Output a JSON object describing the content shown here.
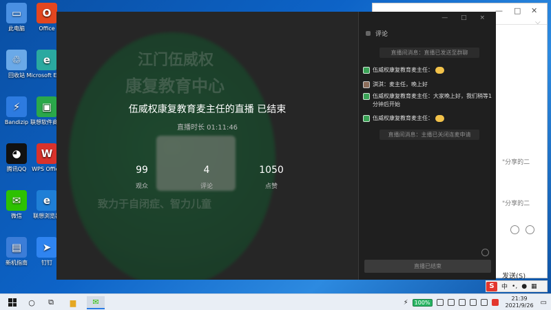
{
  "desktop": {
    "icons": [
      {
        "label": "此电脑",
        "color": "#4a90e2",
        "glyph": "▭",
        "icon": "computer-icon"
      },
      {
        "label": "Office",
        "color": "#e3461f",
        "glyph": "O",
        "icon": "office-icon"
      },
      {
        "label": "回收站",
        "color": "#6aa9e8",
        "glyph": "♲",
        "icon": "recycle-bin-icon"
      },
      {
        "label": "Microsoft Edge",
        "color": "#2aa9a0",
        "glyph": "e",
        "icon": "edge-icon"
      },
      {
        "label": "Bandizip",
        "color": "#2d7be0",
        "glyph": "⚡",
        "icon": "bandizip-icon"
      },
      {
        "label": "联想软件商店",
        "color": "#2aa84a",
        "glyph": "▣",
        "icon": "store-icon"
      },
      {
        "label": "腾讯QQ",
        "color": "#111111",
        "glyph": "◕",
        "icon": "qq-icon"
      },
      {
        "label": "WPS Office",
        "color": "#d9322b",
        "glyph": "W",
        "icon": "wps-icon"
      },
      {
        "label": "微信",
        "color": "#2dc100",
        "glyph": "✉",
        "icon": "wechat-icon"
      },
      {
        "label": "联想浏览器",
        "color": "#1f7fd6",
        "glyph": "e",
        "icon": "lenovo-browser-icon"
      },
      {
        "label": "新机指南",
        "color": "#3b7dd8",
        "glyph": "▤",
        "icon": "guide-icon"
      },
      {
        "label": "钉钉",
        "color": "#2f84f0",
        "glyph": "➤",
        "icon": "dingtalk-icon"
      }
    ]
  },
  "bg_window": {
    "snip1": "\"分享的二",
    "snip2": "\"分享的二",
    "send_label": "发送(S)"
  },
  "live": {
    "cover_line1": "江门伍威权",
    "cover_line2": "康复教育中心",
    "cover_line3": "致力于自闭症、智力儿童",
    "title": "伍威权康复教育麦主任的直播 已结束",
    "duration": "直播时长 01:11:46",
    "stats": [
      {
        "value": "99",
        "label": "观众"
      },
      {
        "value": "4",
        "label": "评论"
      },
      {
        "value": "1050",
        "label": "点赞"
      }
    ]
  },
  "comments": {
    "controls": "— □ ×",
    "header": "评论",
    "sys1": "直播间消息：直播已发送至群聊",
    "items": [
      {
        "text": "伍威权康复教育麦主任：",
        "emoji": true
      },
      {
        "text": "淇淇：麦主任，晚上好",
        "emoji": false
      },
      {
        "text": "伍威权康复教育麦主任：大家晚上好，我们稍等1分钟后开始",
        "emoji": false
      },
      {
        "text": "伍威权康复教育麦主任：",
        "emoji": true
      }
    ],
    "sys2": "直播间消息：主播已关闭连麦申请",
    "ended_button": "直播已结束"
  },
  "taskbar": {
    "battery": "100%",
    "time": "21:39",
    "date": "2021/9/26"
  },
  "ime": {
    "lang": "中",
    "punct": "•,",
    "mic": "🎤"
  }
}
